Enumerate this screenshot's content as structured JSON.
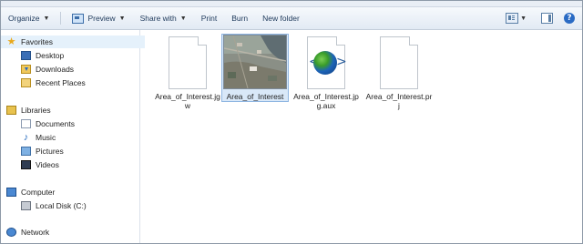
{
  "toolbar": {
    "organize": "Organize",
    "preview": "Preview",
    "share_with": "Share with",
    "print": "Print",
    "burn": "Burn",
    "new_folder": "New folder",
    "help_glyph": "?"
  },
  "nav": {
    "favorites": {
      "label": "Favorites",
      "icon": "star-icon"
    },
    "desktop": {
      "label": "Desktop",
      "icon": "desktop-icon"
    },
    "downloads": {
      "label": "Downloads",
      "icon": "downloads-icon"
    },
    "recent": {
      "label": "Recent Places",
      "icon": "recent-places-icon"
    },
    "libraries": {
      "label": "Libraries",
      "icon": "libraries-icon"
    },
    "documents": {
      "label": "Documents",
      "icon": "documents-icon"
    },
    "music": {
      "label": "Music",
      "icon": "music-icon"
    },
    "pictures": {
      "label": "Pictures",
      "icon": "pictures-icon"
    },
    "videos": {
      "label": "Videos",
      "icon": "videos-icon"
    },
    "computer": {
      "label": "Computer",
      "icon": "computer-icon"
    },
    "local_disk": {
      "label": "Local Disk (C:)",
      "icon": "local-disk-icon"
    },
    "network": {
      "label": "Network",
      "icon": "network-icon"
    }
  },
  "files": [
    {
      "name": "Area_of_Interest.jgw",
      "icon": "blank-document-icon"
    },
    {
      "name": "Area_of_Interest",
      "icon": "aerial-image-thumbnail",
      "selected": true
    },
    {
      "name": "Area_of_Interest.jpg.aux",
      "icon": "xml-globe-icon"
    },
    {
      "name": "Area_of_Interest.prj",
      "icon": "blank-document-icon"
    }
  ],
  "colors": {
    "selection": "#d9e8f8",
    "selection_border": "#8fb6e2",
    "toolbar_text": "#1e395b"
  }
}
